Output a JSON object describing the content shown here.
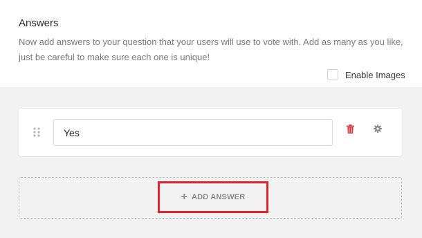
{
  "section": {
    "title": "Answers",
    "description": "Now add answers to your question that your users will use to vote with. Add as many as you like, just be careful to make sure each one is unique!"
  },
  "enable_images": {
    "label": "Enable Images",
    "checked": false
  },
  "answers": [
    {
      "value": "Yes"
    }
  ],
  "add_answer": {
    "icon": "plus-icon",
    "label": "ADD ANSWER"
  },
  "colors": {
    "delete": "#e0393e",
    "highlight": "#e3232c",
    "settings": "#8a8a8a"
  }
}
